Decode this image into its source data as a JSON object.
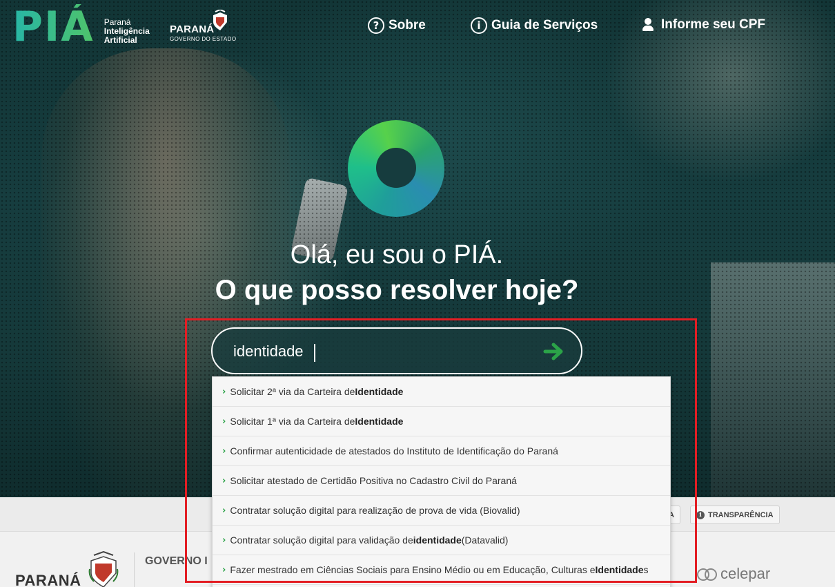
{
  "header": {
    "logo_text": "PIÁ",
    "logo_sub": [
      "Paraná",
      "Inteligência",
      "Artificial"
    ],
    "state_name": "PARANÁ",
    "state_sub": "GOVERNO DO ESTADO",
    "nav": {
      "sobre": "Sobre",
      "guia": "Guia de Serviços",
      "cpf": "Informe seu CPF"
    }
  },
  "hero": {
    "greeting": "Olá, eu sou o PIÁ.",
    "question": "O que posso resolver hoje?"
  },
  "search": {
    "value": "identidade"
  },
  "suggestions": [
    {
      "pre": "Solicitar 2ª via da Carteira de ",
      "bold": "Identidade",
      "post": ""
    },
    {
      "pre": "Solicitar 1ª via da Carteira de ",
      "bold": "Identidade",
      "post": ""
    },
    {
      "pre": "Confirmar autenticidade de atestados do Instituto de Identificação do Paraná",
      "bold": "",
      "post": ""
    },
    {
      "pre": "Solicitar atestado de Certidão Positiva no Cadastro Civil do Paraná",
      "bold": "",
      "post": ""
    },
    {
      "pre": "Contratar solução digital para realização de prova de vida (Biovalid)",
      "bold": "",
      "post": ""
    },
    {
      "pre": "Contratar solução digital para validação de ",
      "bold": "identidade",
      "post": " (Datavalid)"
    },
    {
      "pre": "Fazer mestrado em Ciências Sociais para Ensino Médio ou em Educação, Culturas e ",
      "bold": "Identidade",
      "post": "s"
    }
  ],
  "footer": {
    "pill_a": "A",
    "transparencia": "TRANSPARÊNCIA",
    "parana": "PARANÁ",
    "governo": "GOVERNO I",
    "celepar": "celepar"
  },
  "colors": {
    "accent_green": "#2ba348",
    "highlight_red": "#e31e24",
    "hero_bg": "#163c3e"
  }
}
